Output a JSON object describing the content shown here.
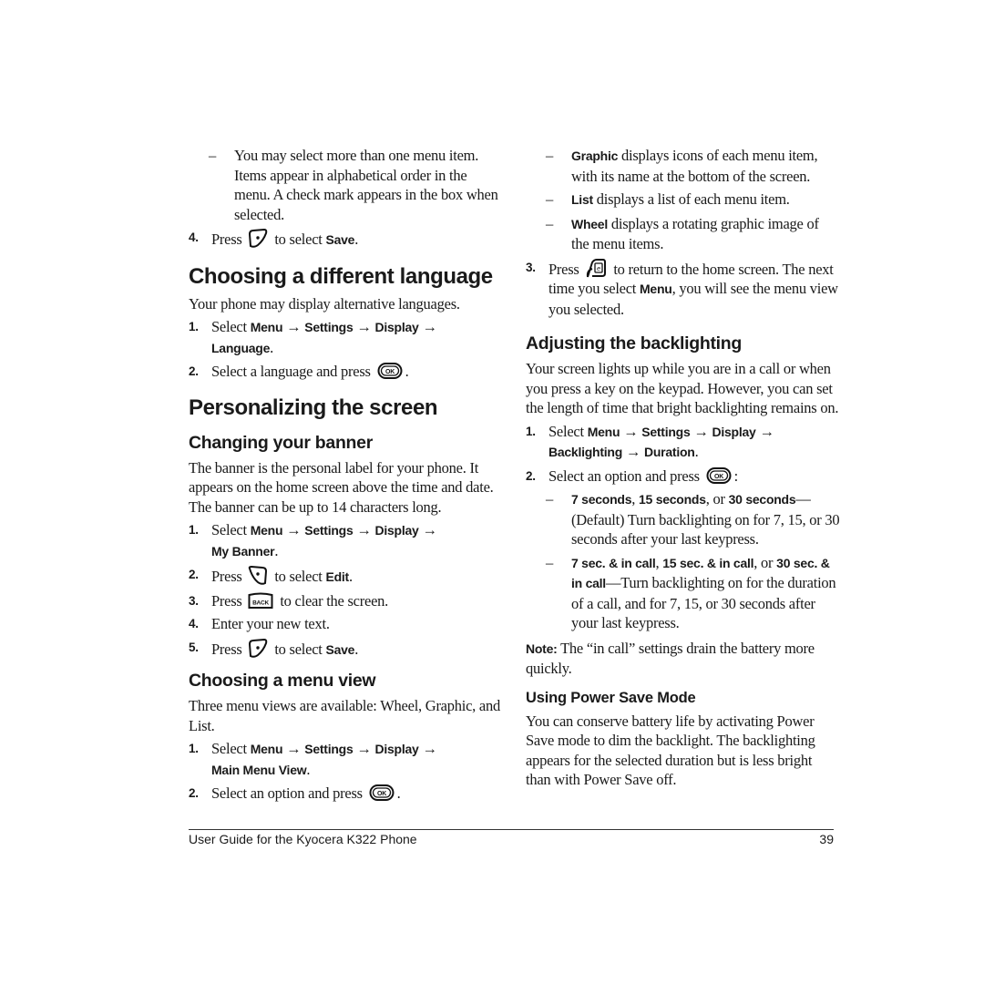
{
  "left": {
    "top_bullet": "You may select more than one menu item. Items appear in alphabetical order in the menu. A check mark appears in the box when selected.",
    "top_step": {
      "num": "4.",
      "pre": "Press",
      "post": "to select",
      "bold": "Save",
      "end": ".",
      "icon": "left-softkey-icon"
    },
    "lang": {
      "title": "Choosing a different language",
      "intro": "Your phone may display alternative languages.",
      "step1": {
        "num": "1.",
        "pre": "Select",
        "path": [
          "Menu",
          "Settings",
          "Display",
          "Language"
        ],
        "end": "."
      },
      "step2": {
        "num": "2.",
        "text": "Select a language and press",
        "end": ".",
        "icon": "ok-key-icon"
      }
    },
    "personalize": {
      "title": "Personalizing the screen",
      "banner": {
        "title": "Changing your banner",
        "intro": "The banner is the personal label for your phone. It appears on the home screen above the time and date. The banner can be up to 14 characters long.",
        "step1": {
          "num": "1.",
          "pre": "Select",
          "path": [
            "Menu",
            "Settings",
            "Display",
            "My Banner"
          ],
          "end": "."
        },
        "step2": {
          "num": "2.",
          "pre": "Press",
          "post": "to select",
          "bold": "Edit",
          "end": ".",
          "icon": "right-softkey-icon"
        },
        "step3": {
          "num": "3.",
          "pre": "Press",
          "post": "to clear the screen.",
          "icon": "back-key-icon",
          "key_label": "BACK"
        },
        "step4": {
          "num": "4.",
          "text": "Enter your new text."
        },
        "step5": {
          "num": "5.",
          "pre": "Press",
          "post": "to select",
          "bold": "Save",
          "end": ".",
          "icon": "left-softkey-icon"
        }
      },
      "menu_view": {
        "title": "Choosing a menu view",
        "intro": "Three menu views are available: Wheel, Graphic, and List.",
        "step1": {
          "num": "1.",
          "pre": "Select",
          "path": [
            "Menu",
            "Settings",
            "Display",
            "Main Menu View"
          ],
          "end": "."
        },
        "step2": {
          "num": "2.",
          "text": "Select an option and press",
          "end": ".",
          "icon": "ok-key-icon"
        }
      }
    }
  },
  "right": {
    "bullets": [
      {
        "bold": "Graphic",
        "text": " displays icons of each menu item, with its name at the bottom of the screen."
      },
      {
        "bold": "List",
        "text": " displays a list of each menu item."
      },
      {
        "bold": "Wheel",
        "text": " displays a rotating graphic image of the menu items."
      }
    ],
    "step3": {
      "num": "3.",
      "pre": "Press",
      "post": "to return to the home screen. The next time you select",
      "bold": "Menu",
      "end": ", you will see the menu view you selected.",
      "icon": "end-key-icon"
    },
    "backlight": {
      "title": "Adjusting the backlighting",
      "intro": "Your screen lights up while you are in a call or when you press a key on the keypad. However, you can set the length of time that bright backlighting remains on.",
      "step1": {
        "num": "1.",
        "pre": "Select",
        "path": [
          "Menu",
          "Settings",
          "Display",
          "Backlighting",
          "Duration"
        ],
        "end": "."
      },
      "step2": {
        "num": "2.",
        "text": "Select an option and press",
        "end": ":",
        "icon": "ok-key-icon"
      },
      "options": [
        {
          "b1": "7 seconds",
          "s1": ", ",
          "b2": "15 seconds",
          "s2": ", or ",
          "b3": "30 seconds",
          "text": "—(Default) Turn backlighting on for 7, 15, or 30 seconds after your last keypress."
        },
        {
          "b1": "7 sec. & in call",
          "s1": ", ",
          "b2": "15 sec. & in call",
          "s2": ", or ",
          "b3": "30 sec. & in call",
          "text": "—Turn backlighting on for the duration of a call, and for 7, 15, or 30 seconds after your last keypress."
        }
      ],
      "note_label": "Note:",
      "note_text": " The “in call” settings drain the battery more quickly."
    },
    "power_save": {
      "title": "Using Power Save Mode",
      "text": "You can conserve battery life by activating Power Save mode to dim the backlight. The backlighting appears for the selected duration but is less bright than with Power Save off."
    }
  },
  "footer": {
    "title": "User Guide for the Kyocera K322 Phone",
    "page": "39"
  },
  "glyphs": {
    "dash": "–",
    "arrow": "→"
  }
}
